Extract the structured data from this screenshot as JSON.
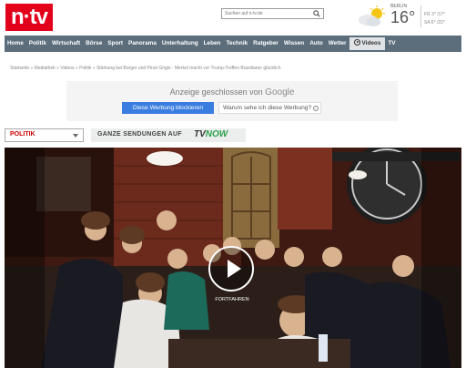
{
  "header": {
    "logo_text": "n·tv",
    "search": {
      "placeholder": "Suchen auf n-tv.de"
    },
    "weather": {
      "city": "BERLIN",
      "temperature": "16°",
      "forecast": [
        {
          "day": "FR",
          "range": "3° /17°"
        },
        {
          "day": "SA",
          "range": "6° /22°"
        }
      ]
    }
  },
  "nav": {
    "items": [
      "Home",
      "Politik",
      "Wirtschaft",
      "Börse",
      "Sport",
      "Panorama",
      "Unterhaltung",
      "Leben",
      "Technik",
      "Ratgeber",
      "Wissen",
      "Auto",
      "Wetter"
    ],
    "active": "Videos",
    "after": "TV"
  },
  "breadcrumb": "Startseite » Mediathek » Videos » Politik » Stärkung bei Burger und Pinot Grigio : Merkel macht vor Trump-Treffen Brasilianer glücklich",
  "ad": {
    "closed_text": "Anzeige geschlossen von",
    "google": "Google",
    "stop_button": "Diese Werbung blockieren",
    "why_button": "Warum sehe ich diese Werbung?",
    "info_icon": "i"
  },
  "controls": {
    "category": "POLITIK",
    "full_shows_label": "GANZE SENDUNGEN AUF",
    "tvnow_tv": "TV",
    "tvnow_now": "NOW"
  },
  "video": {
    "play_label": "FORTFAHREN"
  },
  "colors": {
    "brand_red": "#e2001a",
    "nav_bg": "#5c6e7c",
    "blue_button": "#3a7de0",
    "tvnow_green": "#2aa14a"
  }
}
